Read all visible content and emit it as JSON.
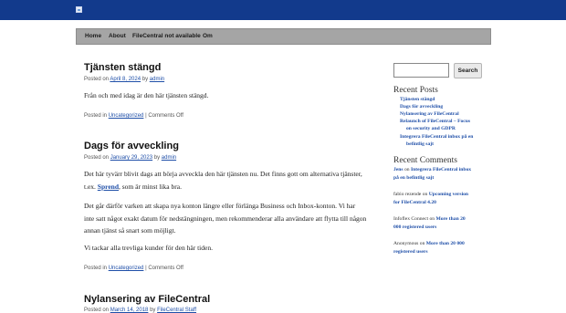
{
  "nav": {
    "items": [
      "Home",
      "About",
      "FileCentral not available",
      "Om"
    ]
  },
  "posts": [
    {
      "title": "Tjänsten stängd",
      "meta_prefix": "Posted on",
      "date": "April 8, 2024",
      "by": "by",
      "author": "admin",
      "paragraphs": [
        "Från och med idag är den här tjänsten stängd."
      ],
      "footer_prefix": "Posted in",
      "category": "Uncategorized",
      "comments": "Comments Off"
    },
    {
      "title": "Dags för avveckling",
      "meta_prefix": "Posted on",
      "date": "January 29, 2023",
      "by": "by",
      "author": "admin",
      "p1_before": "Det här tyvärr blivit dags att börja avveckla den här tjänsten nu. Det finns gott om alternativa tjänster, t.ex.",
      "p1_link": "Sprend",
      "p1_after": ", som är minst lika bra.",
      "p2": "Det går därför varken att skapa nya konton längre eller förlänga Business och Inbox-konton. Vi har inte satt något exakt datum för nedstängningen, men rekommenderar alla användare att flytta till någon annan tjänst så snart som möjligt.",
      "p3": "Vi tackar alla trevliga kunder för den här tiden.",
      "footer_prefix": "Posted in",
      "category": "Uncategorized",
      "comments": "Comments Off"
    },
    {
      "title": "Nylansering av FileCentral",
      "meta_prefix": "Posted on",
      "date": "March 14, 2018",
      "by": "by",
      "author": "FileCentral Staff"
    }
  ],
  "search": {
    "placeholder": "",
    "button_label": "Search"
  },
  "sidebar": {
    "recent_posts_title": "Recent Posts",
    "recent_posts": [
      "Tjänsten stängd",
      "Dags för avveckling",
      "Nylansering av FileCentral",
      "Relaunch of FileCentral – Focus",
      "on security and GDPR",
      "Integrera FileCentral inbox på en",
      "befintlig sajt"
    ],
    "recent_comments_title": "Recent Comments",
    "recent_comments": [
      {
        "author": "Jens",
        "on": "on",
        "post_l1": "Integrera FileCentral inbox",
        "post_l2": "på en befintlig sajt",
        "author_is_link": true
      },
      {
        "author": "fabio rezende",
        "on": "on",
        "post_l1": "Upcoming version",
        "post_l2": "for FileCentral 4.20",
        "author_is_link": false
      },
      {
        "author": "Infoflex Connect",
        "on": "on",
        "post_l1": "More than 20",
        "post_l2": "000 registered users",
        "author_is_link": false
      },
      {
        "author": "Anonymous",
        "on": "on",
        "post_l1": "More than 20 000",
        "post_l2": "registered users",
        "author_is_link": false
      }
    ]
  }
}
